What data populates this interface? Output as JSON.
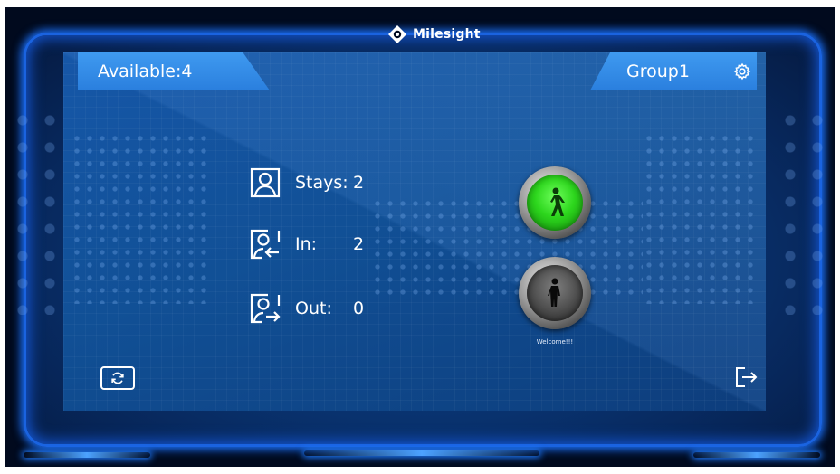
{
  "brand": {
    "name": "Milesight"
  },
  "header": {
    "available_label": "Available:",
    "available_count": "4",
    "group_label": "Group1"
  },
  "stats": [
    {
      "label": "Stays:",
      "value": "2",
      "icon": "person-icon"
    },
    {
      "label": "In:",
      "value": "2",
      "icon": "person-in-icon"
    },
    {
      "label": "Out:",
      "value": "0",
      "icon": "person-out-icon"
    }
  ],
  "lights": {
    "go": {
      "state": "on",
      "color": "#2dd61d",
      "icon": "walking-person-icon"
    },
    "stop": {
      "state": "off",
      "color": "#4c4c4c",
      "icon": "standing-person-icon"
    }
  },
  "message": "Welcome!!!",
  "controls": {
    "refresh_icon": "refresh-icon",
    "exit_icon": "exit-icon",
    "settings_icon": "gear-icon"
  },
  "colors": {
    "accent": "#2a7fde",
    "frame_glow": "#1b73ff",
    "panel": "#115096"
  }
}
